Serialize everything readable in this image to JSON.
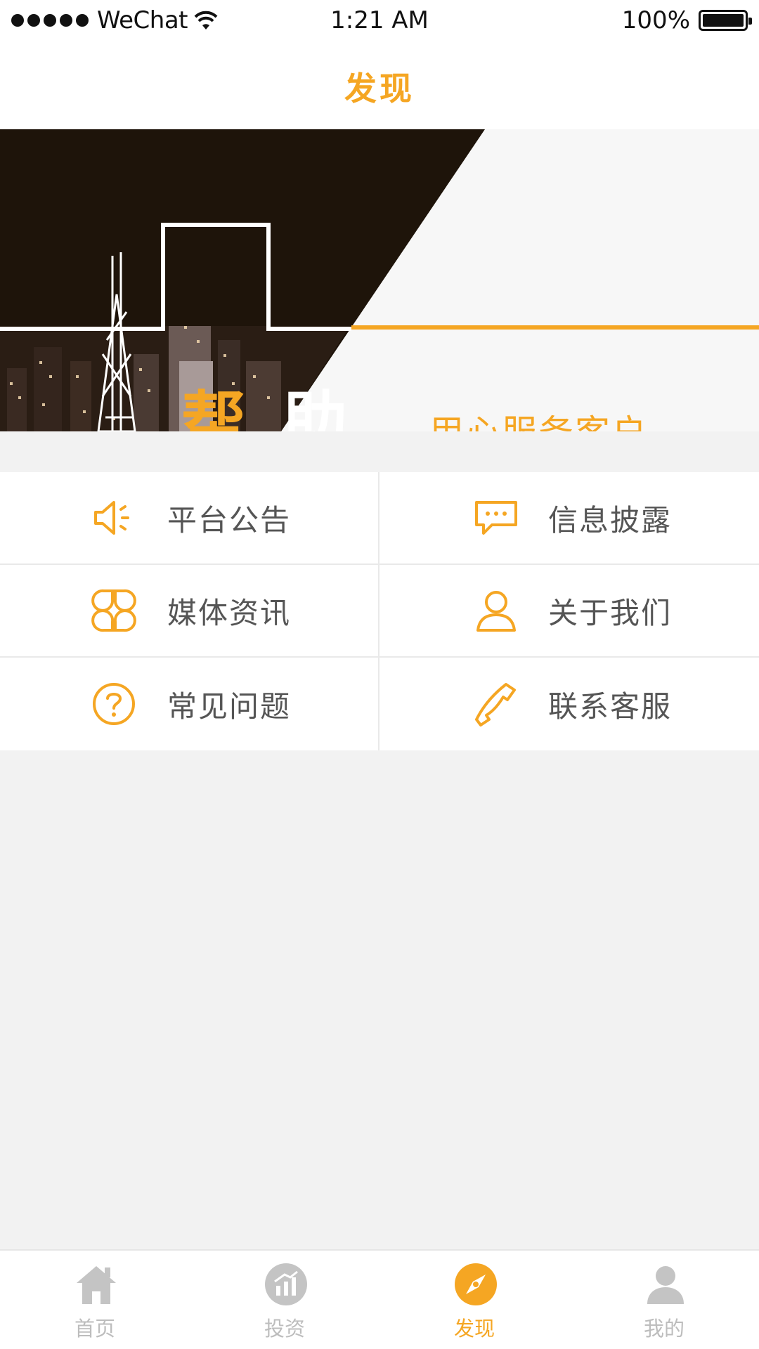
{
  "status_bar": {
    "carrier": "WeChat",
    "time": "1:21 AM",
    "battery": "100%"
  },
  "header": {
    "title": "发现"
  },
  "banner": {
    "char_1": "帮",
    "char_2": "助",
    "slogan": "用心服务客户"
  },
  "menu": {
    "items": [
      {
        "label": "平台公告",
        "icon": "speaker-icon"
      },
      {
        "label": "信息披露",
        "icon": "message-icon"
      },
      {
        "label": "媒体资讯",
        "icon": "grid-icon"
      },
      {
        "label": "关于我们",
        "icon": "user-icon"
      },
      {
        "label": "常见问题",
        "icon": "question-icon"
      },
      {
        "label": "联系客服",
        "icon": "phone-icon"
      }
    ]
  },
  "tabs": [
    {
      "label": "首页",
      "icon": "home-icon",
      "active": false
    },
    {
      "label": "投资",
      "icon": "chart-icon",
      "active": false
    },
    {
      "label": "发现",
      "icon": "compass-icon",
      "active": true
    },
    {
      "label": "我的",
      "icon": "person-icon",
      "active": false
    }
  ],
  "colors": {
    "accent": "#f5a623",
    "inactive": "#bdbdbd",
    "banner_dark": "#1e140a"
  }
}
